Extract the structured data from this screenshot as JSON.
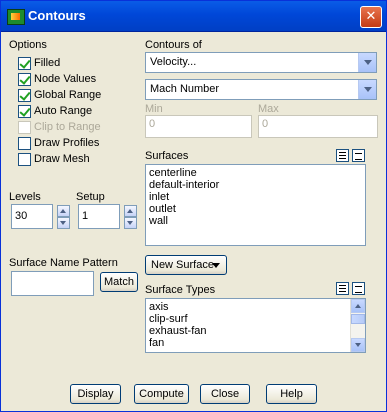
{
  "window": {
    "title": "Contours",
    "close_symbol": "✕"
  },
  "options": {
    "heading": "Options",
    "items": [
      {
        "label": "Filled",
        "checked": true,
        "enabled": true
      },
      {
        "label": "Node Values",
        "checked": true,
        "enabled": true
      },
      {
        "label": "Global Range",
        "checked": true,
        "enabled": true
      },
      {
        "label": "Auto Range",
        "checked": true,
        "enabled": true
      },
      {
        "label": "Clip to Range",
        "checked": false,
        "enabled": false
      },
      {
        "label": "Draw Profiles",
        "checked": false,
        "enabled": true
      },
      {
        "label": "Draw Mesh",
        "checked": false,
        "enabled": true
      }
    ]
  },
  "contours_of": {
    "heading": "Contours of",
    "category": "Velocity...",
    "variable": "Mach Number"
  },
  "range": {
    "min_label": "Min",
    "min_value": "0",
    "max_label": "Max",
    "max_value": "0"
  },
  "surfaces": {
    "heading": "Surfaces",
    "items": [
      "centerline",
      "default-interior",
      "inlet",
      "outlet",
      "wall"
    ]
  },
  "levels": {
    "label": "Levels",
    "value": "30"
  },
  "setup": {
    "label": "Setup",
    "value": "1"
  },
  "surface_name_pattern": {
    "label": "Surface Name Pattern",
    "value": "",
    "match_label": "Match"
  },
  "new_surface": {
    "label": "New Surface"
  },
  "surface_types": {
    "heading": "Surface Types",
    "items": [
      "axis",
      "clip-surf",
      "exhaust-fan",
      "fan"
    ]
  },
  "buttons": {
    "display": "Display",
    "compute": "Compute",
    "close": "Close",
    "help": "Help"
  }
}
